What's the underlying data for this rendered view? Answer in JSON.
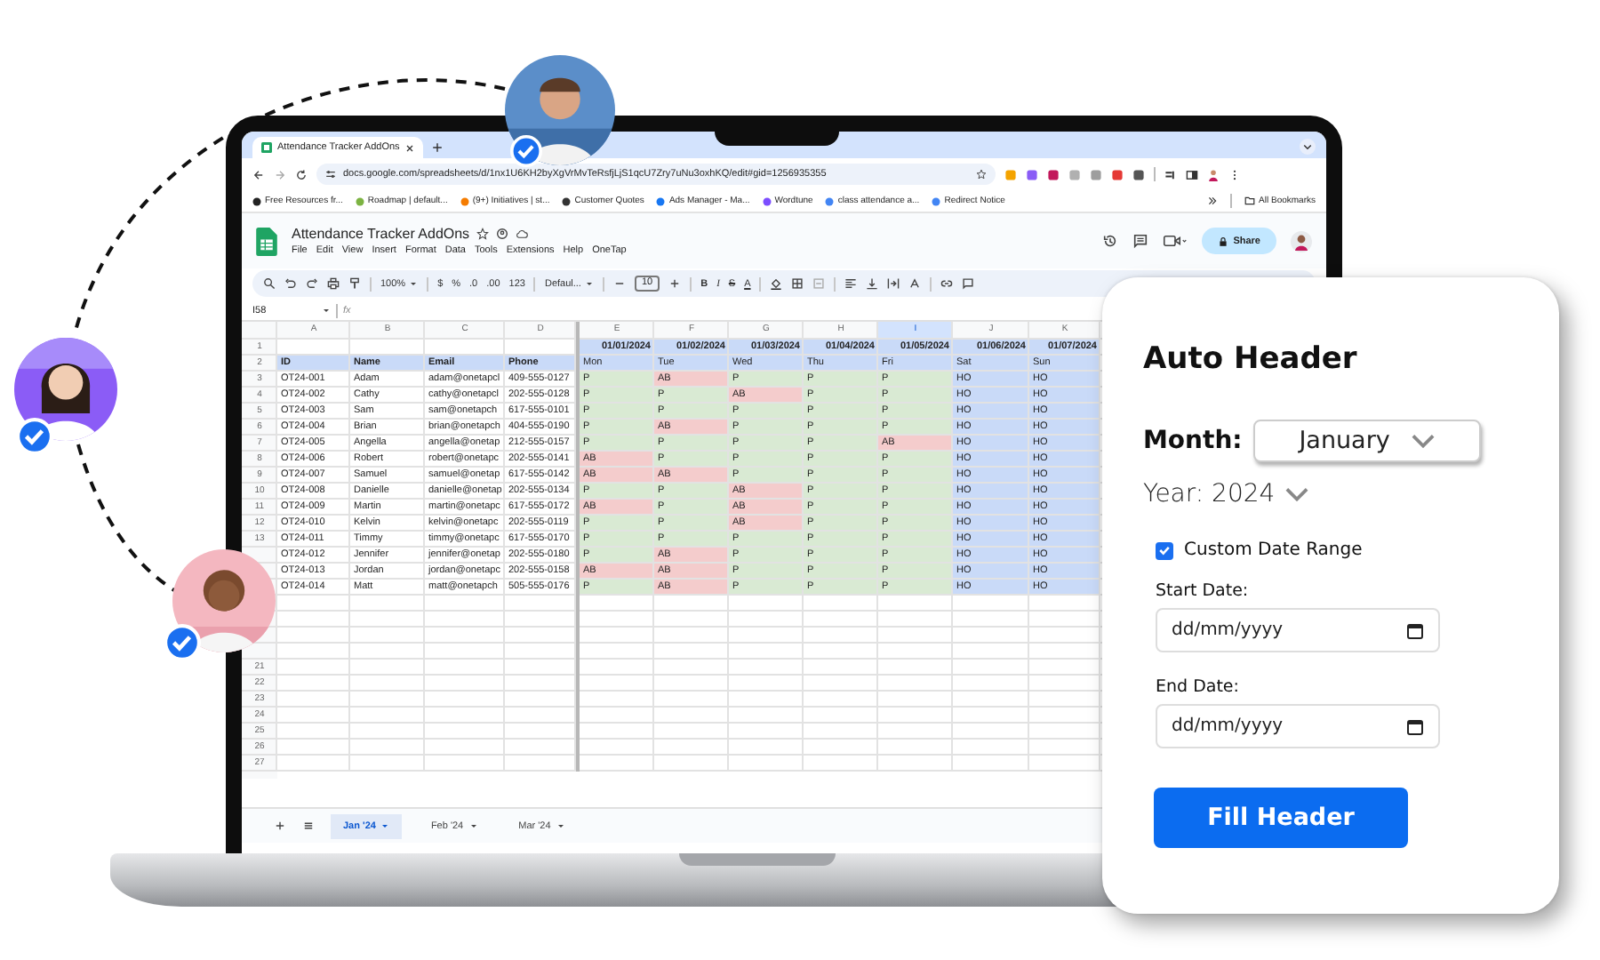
{
  "browser": {
    "tab": {
      "title": "Attendance Tracker AddOns"
    },
    "url": "docs.google.com/spreadsheets/d/1nx1U6KH2byXgVrMvTeRsfjLjS1qcU7Zry7uNu3oxhKQ/edit#gid=1256935355",
    "bookmarks": [
      "Free Resources fr...",
      "Roadmap | default...",
      "(9+) Initiatives | st...",
      "Customer Quotes",
      "Ads Manager - Ma...",
      "Wordtune",
      "class attendance a...",
      "Redirect Notice"
    ],
    "all_bookmarks": "All Bookmarks"
  },
  "sheet": {
    "title": "Attendance Tracker AddOns",
    "menu": [
      "File",
      "Edit",
      "View",
      "Insert",
      "Format",
      "Data",
      "Tools",
      "Extensions",
      "Help",
      "OneTap"
    ],
    "share": "Share",
    "toolbar": {
      "zoom": "100%",
      "currency": "$",
      "percent": "%",
      "decimal_decrease": ".0",
      "decimal_increase": ".00",
      "number_format": "123",
      "font": "Defaul...",
      "font_size": "10",
      "bold": "B",
      "italic": "I",
      "strikethrough": "S",
      "text_color": "A"
    },
    "name_box": "I58",
    "formula_label": "fx",
    "columns": [
      {
        "label": "A",
        "selected": false
      },
      {
        "label": "B",
        "selected": false
      },
      {
        "label": "C",
        "selected": false
      },
      {
        "label": "D",
        "selected": false
      },
      {
        "label": "E",
        "selected": false
      },
      {
        "label": "F",
        "selected": false
      },
      {
        "label": "G",
        "selected": false
      },
      {
        "label": "H",
        "selected": false
      },
      {
        "label": "I",
        "selected": true
      },
      {
        "label": "J",
        "selected": false
      },
      {
        "label": "K",
        "selected": false
      }
    ],
    "date_row": {
      "number": "1",
      "dates": [
        "01/01/2024",
        "01/02/2024",
        "01/03/2024",
        "01/04/2024",
        "01/05/2024",
        "01/06/2024",
        "01/07/2024"
      ]
    },
    "header_row": {
      "number": "2",
      "fields": [
        "ID",
        "Name",
        "Email",
        "Phone"
      ],
      "days": [
        "Mon",
        "Tue",
        "Wed",
        "Thu",
        "Fri",
        "Sat",
        "Sun"
      ]
    },
    "rows": [
      {
        "number": "3",
        "id": "OT24-001",
        "name": "Adam",
        "email": "adam@onetapcl",
        "phone": "409-555-0127",
        "marks": [
          {
            "text": "P",
            "color": "#d9ead3"
          },
          {
            "text": "AB",
            "color": "#f4cccc"
          },
          {
            "text": "P",
            "color": "#d9ead3"
          },
          {
            "text": "P",
            "color": "#d9ead3"
          },
          {
            "text": "P",
            "color": "#d9ead3"
          },
          {
            "text": "HO",
            "color": "#c9daf8"
          },
          {
            "text": "HO",
            "color": "#c9daf8"
          }
        ]
      },
      {
        "number": "4",
        "id": "OT24-002",
        "name": "Cathy",
        "email": "cathy@onetapcl",
        "phone": "202-555-0128",
        "marks": [
          {
            "text": "P",
            "color": "#d9ead3"
          },
          {
            "text": "P",
            "color": "#d9ead3"
          },
          {
            "text": "AB",
            "color": "#f4cccc"
          },
          {
            "text": "P",
            "color": "#d9ead3"
          },
          {
            "text": "P",
            "color": "#d9ead3"
          },
          {
            "text": "HO",
            "color": "#c9daf8"
          },
          {
            "text": "HO",
            "color": "#c9daf8"
          }
        ]
      },
      {
        "number": "5",
        "id": "OT24-003",
        "name": "Sam",
        "email": "sam@onetapch",
        "phone": "617-555-0101",
        "marks": [
          {
            "text": "P",
            "color": "#d9ead3"
          },
          {
            "text": "P",
            "color": "#d9ead3"
          },
          {
            "text": "P",
            "color": "#d9ead3"
          },
          {
            "text": "P",
            "color": "#d9ead3"
          },
          {
            "text": "P",
            "color": "#d9ead3"
          },
          {
            "text": "HO",
            "color": "#c9daf8"
          },
          {
            "text": "HO",
            "color": "#c9daf8"
          }
        ]
      },
      {
        "number": "6",
        "id": "OT24-004",
        "name": "Brian",
        "email": "brian@onetapch",
        "phone": "404-555-0190",
        "marks": [
          {
            "text": "P",
            "color": "#d9ead3"
          },
          {
            "text": "AB",
            "color": "#f4cccc"
          },
          {
            "text": "P",
            "color": "#d9ead3"
          },
          {
            "text": "P",
            "color": "#d9ead3"
          },
          {
            "text": "P",
            "color": "#d9ead3"
          },
          {
            "text": "HO",
            "color": "#c9daf8"
          },
          {
            "text": "HO",
            "color": "#c9daf8"
          }
        ]
      },
      {
        "number": "7",
        "id": "OT24-005",
        "name": "Angella",
        "email": "angella@onetap",
        "phone": "212-555-0157",
        "marks": [
          {
            "text": "P",
            "color": "#d9ead3"
          },
          {
            "text": "P",
            "color": "#d9ead3"
          },
          {
            "text": "P",
            "color": "#d9ead3"
          },
          {
            "text": "P",
            "color": "#d9ead3"
          },
          {
            "text": "AB",
            "color": "#f4cccc"
          },
          {
            "text": "HO",
            "color": "#c9daf8"
          },
          {
            "text": "HO",
            "color": "#c9daf8"
          }
        ]
      },
      {
        "number": "8",
        "id": "OT24-006",
        "name": "Robert",
        "email": "robert@onetapc",
        "phone": "202-555-0141",
        "marks": [
          {
            "text": "AB",
            "color": "#f4cccc"
          },
          {
            "text": "P",
            "color": "#d9ead3"
          },
          {
            "text": "P",
            "color": "#d9ead3"
          },
          {
            "text": "P",
            "color": "#d9ead3"
          },
          {
            "text": "P",
            "color": "#d9ead3"
          },
          {
            "text": "HO",
            "color": "#c9daf8"
          },
          {
            "text": "HO",
            "color": "#c9daf8"
          }
        ]
      },
      {
        "number": "9",
        "id": "OT24-007",
        "name": "Samuel",
        "email": "samuel@onetap",
        "phone": "617-555-0142",
        "marks": [
          {
            "text": "AB",
            "color": "#f4cccc"
          },
          {
            "text": "AB",
            "color": "#f4cccc"
          },
          {
            "text": "P",
            "color": "#d9ead3"
          },
          {
            "text": "P",
            "color": "#d9ead3"
          },
          {
            "text": "P",
            "color": "#d9ead3"
          },
          {
            "text": "HO",
            "color": "#c9daf8"
          },
          {
            "text": "HO",
            "color": "#c9daf8"
          }
        ]
      },
      {
        "number": "10",
        "id": "OT24-008",
        "name": "Danielle",
        "email": "danielle@onetap",
        "phone": "202-555-0134",
        "marks": [
          {
            "text": "P",
            "color": "#d9ead3"
          },
          {
            "text": "P",
            "color": "#d9ead3"
          },
          {
            "text": "AB",
            "color": "#f4cccc"
          },
          {
            "text": "P",
            "color": "#d9ead3"
          },
          {
            "text": "P",
            "color": "#d9ead3"
          },
          {
            "text": "HO",
            "color": "#c9daf8"
          },
          {
            "text": "HO",
            "color": "#c9daf8"
          }
        ]
      },
      {
        "number": "11",
        "id": "OT24-009",
        "name": "Martin",
        "email": "martin@onetapc",
        "phone": "617-555-0172",
        "marks": [
          {
            "text": "AB",
            "color": "#f4cccc"
          },
          {
            "text": "P",
            "color": "#d9ead3"
          },
          {
            "text": "AB",
            "color": "#f4cccc"
          },
          {
            "text": "P",
            "color": "#d9ead3"
          },
          {
            "text": "P",
            "color": "#d9ead3"
          },
          {
            "text": "HO",
            "color": "#c9daf8"
          },
          {
            "text": "HO",
            "color": "#c9daf8"
          }
        ]
      },
      {
        "number": "12",
        "id": "OT24-010",
        "name": "Kelvin",
        "email": "kelvin@onetapc",
        "phone": "202-555-0119",
        "marks": [
          {
            "text": "P",
            "color": "#d9ead3"
          },
          {
            "text": "P",
            "color": "#d9ead3"
          },
          {
            "text": "AB",
            "color": "#f4cccc"
          },
          {
            "text": "P",
            "color": "#d9ead3"
          },
          {
            "text": "P",
            "color": "#d9ead3"
          },
          {
            "text": "HO",
            "color": "#c9daf8"
          },
          {
            "text": "HO",
            "color": "#c9daf8"
          }
        ]
      },
      {
        "number": "13",
        "id": "OT24-011",
        "name": "Timmy",
        "email": "timmy@onetapc",
        "phone": "617-555-0170",
        "marks": [
          {
            "text": "P",
            "color": "#d9ead3"
          },
          {
            "text": "P",
            "color": "#d9ead3"
          },
          {
            "text": "P",
            "color": "#d9ead3"
          },
          {
            "text": "P",
            "color": "#d9ead3"
          },
          {
            "text": "P",
            "color": "#d9ead3"
          },
          {
            "text": "HO",
            "color": "#c9daf8"
          },
          {
            "text": "HO",
            "color": "#c9daf8"
          }
        ]
      },
      {
        "id": "OT24-012",
        "name": "Jennifer",
        "email": "jennifer@onetap",
        "phone": "202-555-0180",
        "marks": [
          {
            "text": "P",
            "color": "#d9ead3"
          },
          {
            "text": "AB",
            "color": "#f4cccc"
          },
          {
            "text": "P",
            "color": "#d9ead3"
          },
          {
            "text": "P",
            "color": "#d9ead3"
          },
          {
            "text": "P",
            "color": "#d9ead3"
          },
          {
            "text": "HO",
            "color": "#c9daf8"
          },
          {
            "text": "HO",
            "color": "#c9daf8"
          }
        ]
      },
      {
        "id": "OT24-013",
        "name": "Jordan",
        "email": "jordan@onetapc",
        "phone": "202-555-0158",
        "marks": [
          {
            "text": "AB",
            "color": "#f4cccc"
          },
          {
            "text": "AB",
            "color": "#f4cccc"
          },
          {
            "text": "P",
            "color": "#d9ead3"
          },
          {
            "text": "P",
            "color": "#d9ead3"
          },
          {
            "text": "P",
            "color": "#d9ead3"
          },
          {
            "text": "HO",
            "color": "#c9daf8"
          },
          {
            "text": "HO",
            "color": "#c9daf8"
          }
        ]
      },
      {
        "id": "OT24-014",
        "name": "Matt",
        "email": "matt@onetapch",
        "phone": "505-555-0176",
        "marks": [
          {
            "text": "P",
            "color": "#d9ead3"
          },
          {
            "text": "AB",
            "color": "#f4cccc"
          },
          {
            "text": "P",
            "color": "#d9ead3"
          },
          {
            "text": "P",
            "color": "#d9ead3"
          },
          {
            "text": "P",
            "color": "#d9ead3"
          },
          {
            "text": "HO",
            "color": "#c9daf8"
          },
          {
            "text": "HO",
            "color": "#c9daf8"
          }
        ]
      }
    ],
    "empty_rows": [
      "21",
      "22",
      "23",
      "24",
      "25",
      "26",
      "27"
    ],
    "tabs": [
      {
        "label": "Jan '24",
        "selected": true
      },
      {
        "label": "Feb '24",
        "selected": false
      },
      {
        "label": "Mar '24",
        "selected": false
      }
    ]
  },
  "card": {
    "title": "Auto Header",
    "month": {
      "label": "Month:",
      "value": "January"
    },
    "year": {
      "label": "Year:",
      "value": "2024"
    },
    "custom_range": {
      "label": "Custom Date Range",
      "checked": true
    },
    "start_date": {
      "label": "Start Date:",
      "placeholder": "dd/mm/yyyy"
    },
    "end_date": {
      "label": "End Date:",
      "placeholder": "dd/mm/yyyy"
    },
    "button": "Fill Header"
  }
}
